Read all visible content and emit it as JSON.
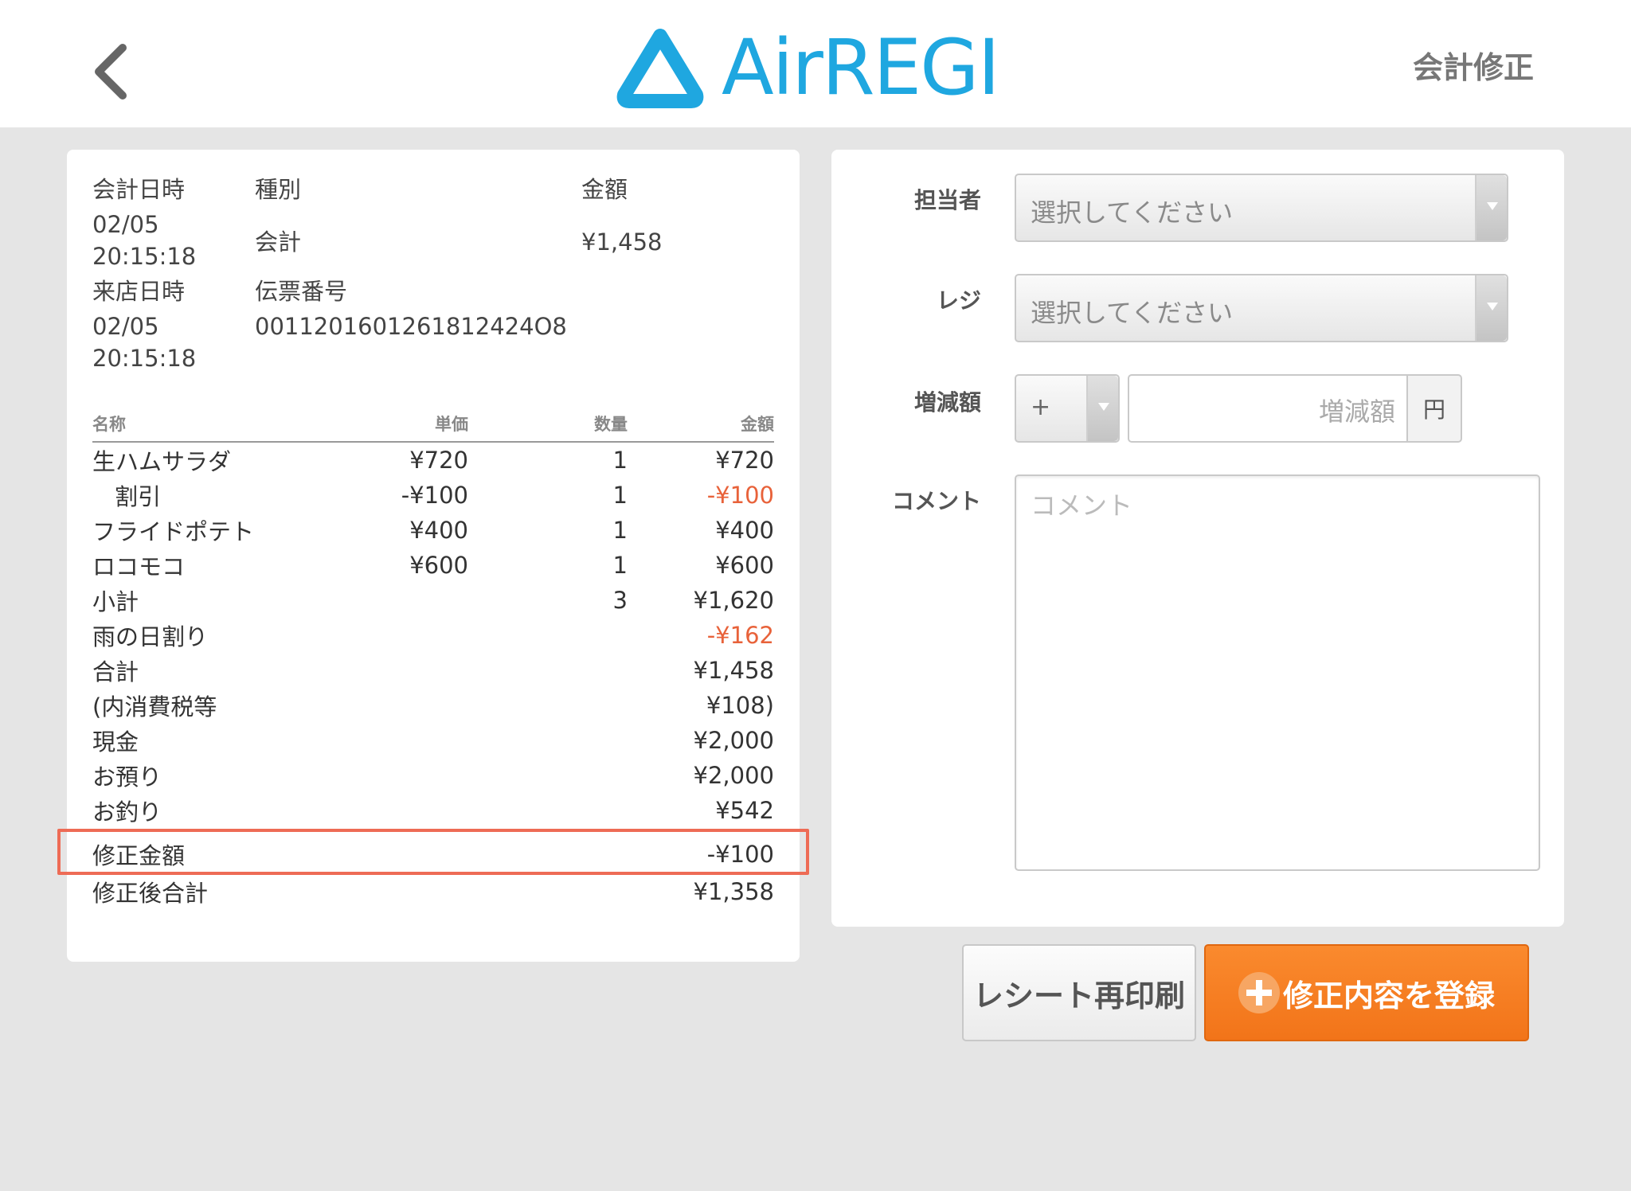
{
  "header": {
    "logo_text": "AirREGI",
    "page_title": "会計修正",
    "brand_color": "#1fa7e0"
  },
  "receipt": {
    "labels": {
      "datetime": "会計日時",
      "type": "種別",
      "amount": "金額",
      "visit_datetime": "来店日時",
      "slip_number": "伝票番号"
    },
    "datetime_date": "02/05",
    "datetime_time": "20:15:18",
    "type_value": "会計",
    "amount_value": "¥1,458",
    "visit_date": "02/05",
    "visit_time": "20:15:18",
    "slip_value": "0011201601261812424O8",
    "columns": {
      "name": "名称",
      "unit": "単価",
      "qty": "数量",
      "amount": "金額"
    },
    "items": [
      {
        "name": "生ハムサラダ",
        "unit": "¥720",
        "qty": "1",
        "amount": "¥720"
      },
      {
        "name": "割引",
        "unit": "-¥100",
        "qty": "1",
        "amount": "-¥100"
      },
      {
        "name": "フライドポテト",
        "unit": "¥400",
        "qty": "1",
        "amount": "¥400"
      },
      {
        "name": "ロコモコ",
        "unit": "¥600",
        "qty": "1",
        "amount": "¥600"
      }
    ],
    "subtotal": {
      "label": "小計",
      "qty": "3",
      "amount": "¥1,620"
    },
    "rain_discount": {
      "label": "雨の日割り",
      "amount": "-¥162"
    },
    "total": {
      "label": "合計",
      "amount": "¥1,458"
    },
    "tax": {
      "label": "(内消費税等",
      "amount": "¥108)"
    },
    "cash": {
      "label": "現金",
      "amount": "¥2,000"
    },
    "deposit": {
      "label": "お預り",
      "amount": "¥2,000"
    },
    "change": {
      "label": "お釣り",
      "amount": "¥542"
    },
    "correction": {
      "label": "修正金額",
      "amount": "-¥100"
    },
    "corrected_total": {
      "label": "修正後合計",
      "amount": "¥1,358"
    }
  },
  "form": {
    "staff_label": "担当者",
    "staff_value": "選択してください",
    "register_label": "レジ",
    "register_value": "選択してください",
    "adjust_label": "増減額",
    "adjust_sign": "+",
    "adjust_placeholder": "増減額",
    "adjust_unit": "円",
    "comment_label": "コメント",
    "comment_placeholder": "コメント"
  },
  "buttons": {
    "reprint": "レシート再印刷",
    "register": "修正内容を登録"
  },
  "colors": {
    "negative": "#e8623a",
    "primary_button": "#f27419",
    "highlight_border": "#ee6b55"
  }
}
